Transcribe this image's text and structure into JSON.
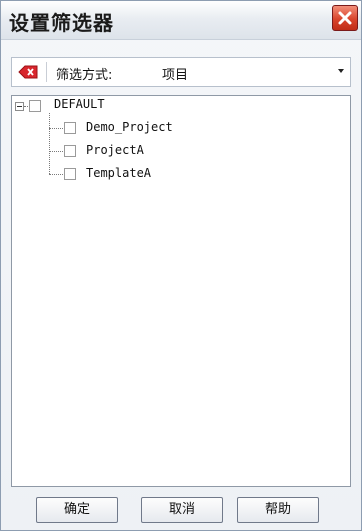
{
  "window": {
    "title": "设置筛选器"
  },
  "toolbar": {
    "icon": "remove-filter-icon",
    "label": "筛选方式:",
    "select_value": "项目"
  },
  "tree": {
    "root": {
      "label": "DEFAULT",
      "expanded": true,
      "checked": false
    },
    "children": [
      {
        "label": "Demo_Project",
        "checked": false
      },
      {
        "label": "ProjectA",
        "checked": false
      },
      {
        "label": "TemplateA",
        "checked": false
      }
    ]
  },
  "buttons": {
    "ok": "确定",
    "cancel": "取消",
    "help": "帮助"
  },
  "colors": {
    "close_button": "#d9442c",
    "tree_border": "#8f99a6"
  }
}
